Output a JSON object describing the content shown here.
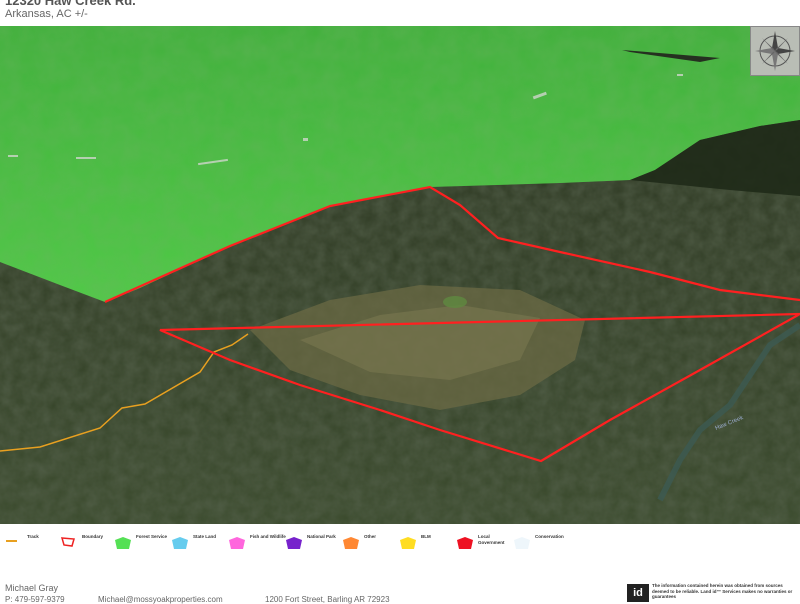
{
  "header": {
    "title": "12320 Haw Creek Rd.",
    "subtitle": "Arkansas,  AC +/-"
  },
  "map": {
    "road_label": "Haw Creek",
    "compass_icon": "compass-rose-icon",
    "colors": {
      "boundary": "#ff2020",
      "track": "#e8a020",
      "forest_service": "#44dd44"
    }
  },
  "legend": {
    "items": [
      {
        "label": "Track",
        "symbol": "line",
        "color": "#e8a020"
      },
      {
        "label": "Boundary",
        "symbol": "outline",
        "color": "#ee2222"
      },
      {
        "label": "Forest Service",
        "symbol": "fill",
        "color": "#55e055"
      },
      {
        "label": "State Land",
        "symbol": "fill",
        "color": "#66ccee"
      },
      {
        "label": "Fish and Wildlife",
        "symbol": "fill",
        "color": "#ff66dd"
      },
      {
        "label": "National Park",
        "symbol": "fill",
        "color": "#7722cc"
      },
      {
        "label": "Other",
        "symbol": "fill",
        "color": "#ff8833"
      },
      {
        "label": "BLM",
        "symbol": "fill",
        "color": "#ffdd22"
      },
      {
        "label": "Local Government",
        "symbol": "fill",
        "color": "#ee1122"
      },
      {
        "label": "Conservation",
        "symbol": "fill",
        "color": "#eef6fb"
      }
    ]
  },
  "footer": {
    "agent_name": "Michael Gray",
    "phone": "P: 479-597-9379",
    "email": "Michael@mossyoakproperties.com",
    "address": "1200 Fort Street, Barling AR 72923",
    "logo_text": "id",
    "disclaimer": "The information contained herein was obtained from sources deemed to be reliable. Land id™ Services makes no warranties or guarantees"
  }
}
